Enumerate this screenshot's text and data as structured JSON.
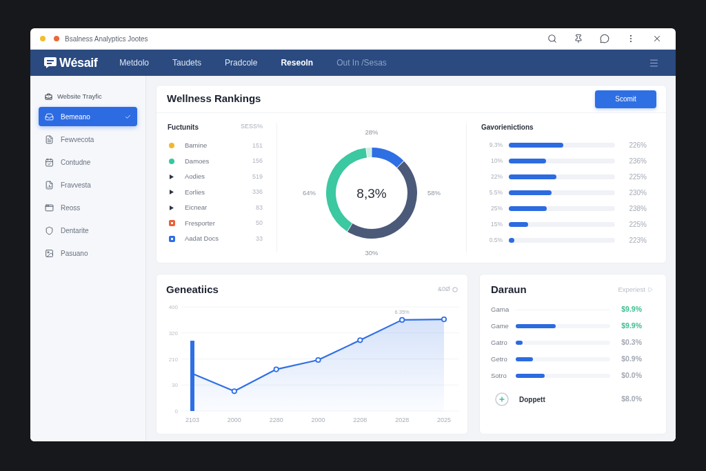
{
  "window": {
    "title": "Bsalness Analyptics Jootes"
  },
  "nav": {
    "logo": "Wésaif",
    "items": [
      {
        "label": "Metdolo",
        "selected": false,
        "disabled": false
      },
      {
        "label": "Taudets",
        "selected": false,
        "disabled": false
      },
      {
        "label": "Pradcole",
        "selected": false,
        "disabled": false
      },
      {
        "label": "Reseoln",
        "selected": true,
        "disabled": false
      },
      {
        "label": "Out In /Sesas",
        "selected": false,
        "disabled": true
      }
    ]
  },
  "sidebar": {
    "heading": "Website Trayfic",
    "items": [
      {
        "label": "Bemeano",
        "selected": true
      },
      {
        "label": "Fewvecota",
        "selected": false
      },
      {
        "label": "Contudne",
        "selected": false
      },
      {
        "label": "Fravvesta",
        "selected": false
      },
      {
        "label": "Reoss",
        "selected": false
      },
      {
        "label": "Dentarite",
        "selected": false
      },
      {
        "label": "Pasuano",
        "selected": false
      }
    ]
  },
  "rankings": {
    "title": "Wellness Rankings",
    "button": "Scomit",
    "legend": {
      "header": "Fuctunits",
      "header_value": "SESS%",
      "rows": [
        {
          "kind": "dot",
          "color": "#f2b632",
          "label": "Bamine",
          "value": "151"
        },
        {
          "kind": "dot",
          "color": "#34c7a0",
          "label": "Damoes",
          "value": "156"
        },
        {
          "kind": "triangle",
          "color": "#2f3542",
          "label": "Aodies",
          "value": "519"
        },
        {
          "kind": "triangle",
          "color": "#2f3542",
          "label": "Eorlies",
          "value": "336"
        },
        {
          "kind": "triangle",
          "color": "#2f3542",
          "label": "Eicnear",
          "value": "83"
        },
        {
          "kind": "square",
          "color": "#e8613a",
          "label": "Fresporter",
          "value": "50"
        },
        {
          "kind": "square",
          "color": "#2f6fe4",
          "label": "Aadat Docs",
          "value": "33"
        }
      ]
    },
    "donut": {
      "center": "8,3%",
      "labels": [
        "28%",
        "64%",
        "58%",
        "30%"
      ],
      "chart_data": {
        "type": "donut",
        "values": [
          12.5,
          46.5,
          39,
          2
        ],
        "colors": [
          "#2f6fe4",
          "#4b5a78",
          "#3cc8a0",
          "#cfeee3"
        ]
      }
    },
    "bars": {
      "header": "Gavorienictions",
      "rows": [
        {
          "label": "9.3%",
          "level": 0.51,
          "value": "226%"
        },
        {
          "label": "10%",
          "level": 0.35,
          "value": "236%"
        },
        {
          "label": "22%",
          "level": 0.45,
          "value": "225%"
        },
        {
          "label": "5.5%",
          "level": 0.4,
          "value": "230%"
        },
        {
          "label": "25%",
          "level": 0.36,
          "value": "238%"
        },
        {
          "label": "15%",
          "level": 0.18,
          "value": "225%"
        },
        {
          "label": "0.5%",
          "level": 0.05,
          "value": "223%"
        }
      ]
    }
  },
  "generations": {
    "title": "Geneatiics",
    "action": "&0Ø",
    "y_labels": [
      "400",
      "320",
      "210",
      "30",
      "0"
    ],
    "x_labels": [
      "2103",
      "2000",
      "2280",
      "2000",
      "2208",
      "2028",
      "2025"
    ],
    "point_label": "6.35%"
  },
  "daraun": {
    "title": "Daraun",
    "link": "Experiest",
    "rows": [
      {
        "kind": "plain",
        "label": "Garna",
        "value": "$9.9%",
        "color": "#3bbf8f"
      },
      {
        "kind": "bar",
        "label": "Game",
        "level": 0.42,
        "value": "$9.9%",
        "color": "#3bbf8f"
      },
      {
        "kind": "bar",
        "label": "Gatro",
        "level": 0.07,
        "value": "$0.3%",
        "color": "#a3a9b3"
      },
      {
        "kind": "bar",
        "label": "Getro",
        "level": 0.18,
        "value": "$0.9%",
        "color": "#a3a9b3"
      },
      {
        "kind": "bar",
        "label": "Sotro",
        "level": 0.31,
        "value": "$0.0%",
        "color": "#a3a9b3"
      },
      {
        "kind": "summary",
        "label": "Doppett",
        "value": "$8.0%",
        "color": "#a3a9b3"
      }
    ]
  }
}
